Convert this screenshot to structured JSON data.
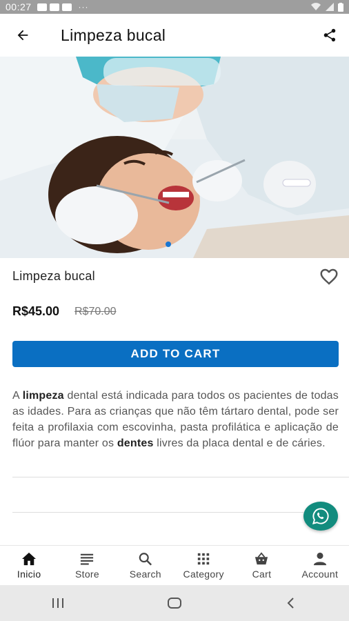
{
  "status_bar": {
    "time": "00:27",
    "dots": "···"
  },
  "app_bar": {
    "title": "Limpeza bucal",
    "back_icon": "arrow-left-icon",
    "share_icon": "share-icon"
  },
  "product": {
    "name": "Limpeza bucal",
    "price": "R$45.00",
    "old_price": "R$70.00",
    "add_to_cart_label": "ADD TO CART"
  },
  "description": {
    "t1": "A ",
    "b1": "limpeza",
    "t2": " dental está indicada para todos os pacientes de todas as idades. Para as crianças que não têm tártaro dental, pode ser feita a profilaxia com escovinha, pasta profilática e aplicação de flúor para manter os ",
    "b2": "dentes",
    "t3": " livres da placa dental e de cáries."
  },
  "bottom_nav": {
    "items": [
      {
        "label": "Inicio",
        "icon": "home-icon"
      },
      {
        "label": "Store",
        "icon": "store-list-icon"
      },
      {
        "label": "Search",
        "icon": "search-icon"
      },
      {
        "label": "Category",
        "icon": "grid-icon"
      },
      {
        "label": "Cart",
        "icon": "basket-icon"
      },
      {
        "label": "Account",
        "icon": "person-icon"
      }
    ]
  },
  "colors": {
    "accent": "#0a6fc2",
    "pager": "#1976d2",
    "whatsapp": "#128c7e"
  }
}
